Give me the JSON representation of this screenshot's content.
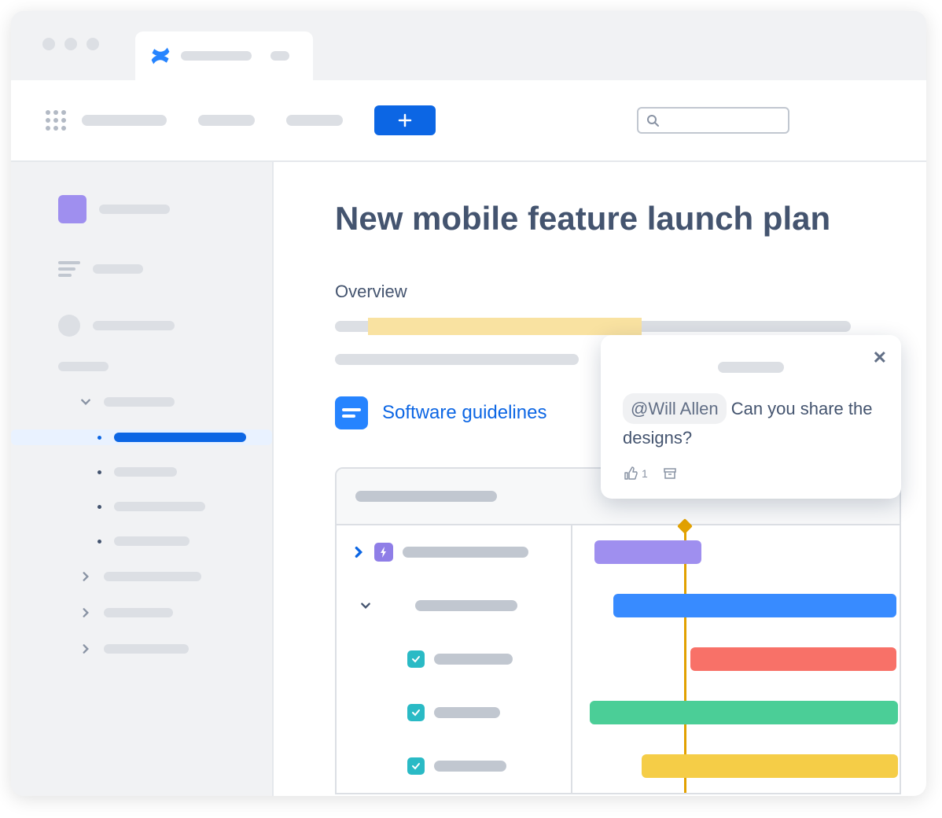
{
  "page": {
    "title": "New mobile feature launch plan",
    "section_title": "Overview",
    "smart_link_label": "Software guidelines"
  },
  "comment": {
    "mention": "@Will Allen",
    "text_after": " Can you share the designs?",
    "like_count": "1"
  },
  "colors": {
    "primary": "#0c66e4",
    "purple": "#9f8fef",
    "blue": "#388bff",
    "red": "#f87168",
    "green": "#4bce97",
    "yellow": "#f5cd47"
  }
}
